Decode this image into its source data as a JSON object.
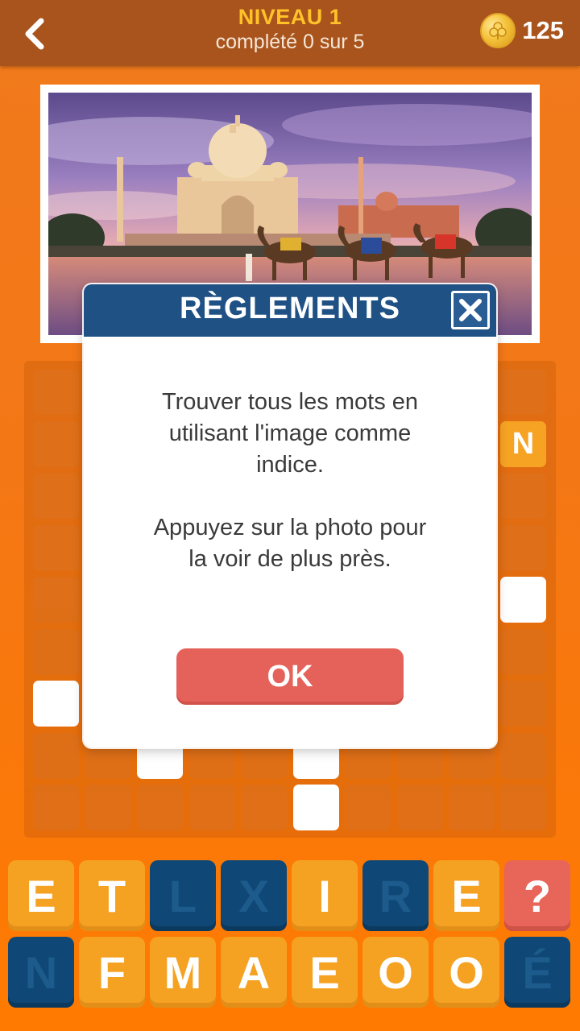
{
  "header": {
    "level_title": "NIVEAU 1",
    "level_progress": "complété 0 sur 5",
    "coins": "125",
    "back_icon": "back-arrow-icon",
    "coin_icon": "coin-icon"
  },
  "grid": {
    "visible_letter": "N"
  },
  "letters": {
    "row1": [
      "E",
      "T",
      "L",
      "X",
      "I",
      "R",
      "E",
      "?"
    ],
    "row2": [
      "N",
      "F",
      "M",
      "A",
      "E",
      "O",
      "O",
      "É"
    ]
  },
  "modal": {
    "title": "RÈGLEMENTS",
    "line1": "Trouver tous les mots en",
    "line2": "utilisant l'image comme",
    "line3": "indice.",
    "line4": "Appuyez sur la photo pour",
    "line5": "la voir de plus près.",
    "ok_label": "OK"
  },
  "colors": {
    "header_bg": "#a9541c",
    "accent_yellow": "#ffc229",
    "tile_orange": "#f5a223",
    "tile_blue": "#0f4876",
    "tile_red": "#e8655a",
    "modal_head": "#1f5185"
  }
}
